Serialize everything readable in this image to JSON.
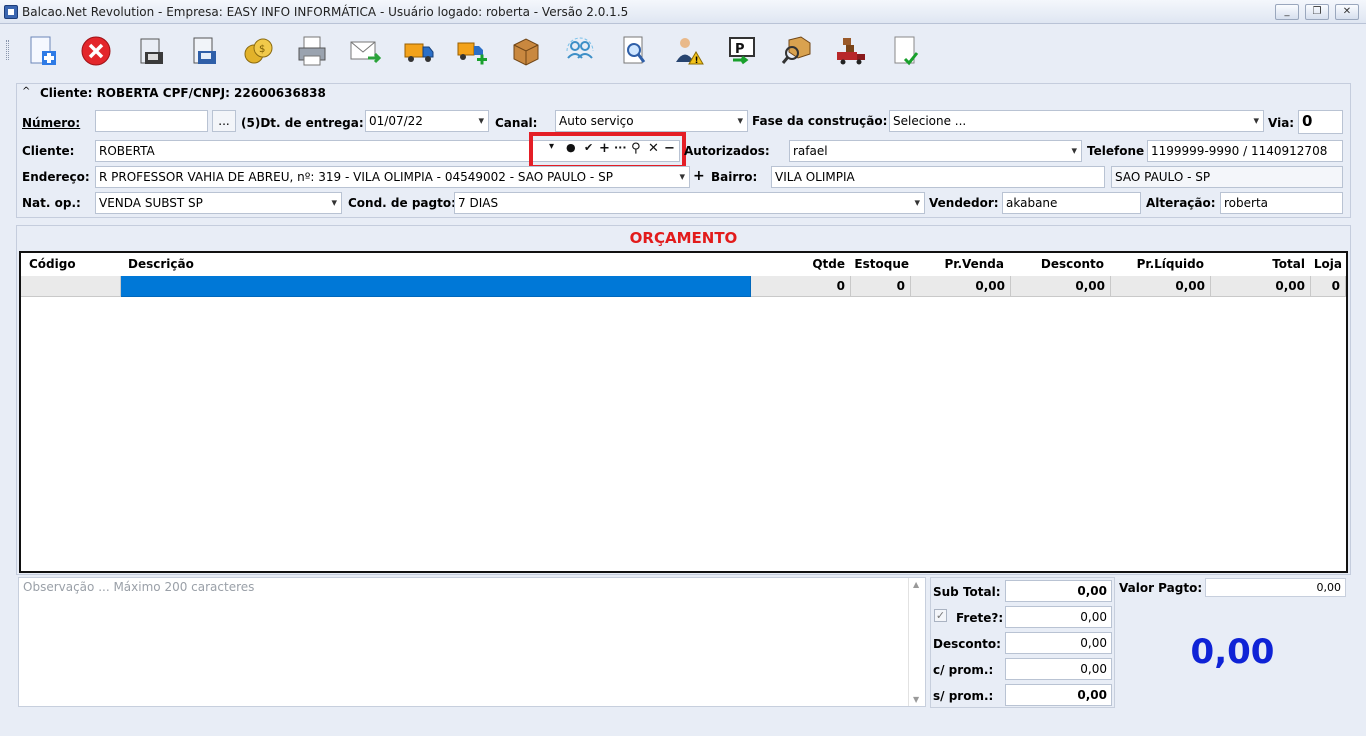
{
  "window": {
    "title": "Balcao.Net Revolution - Empresa: EASY INFO INFORMÁTICA - Usuário logado: roberta - Versão 2.0.1.5",
    "minimize": "_",
    "restore": "❐",
    "close": "✕"
  },
  "toolbar": {
    "buttons": [
      {
        "name": "new-doc-icon"
      },
      {
        "name": "cancel-icon"
      },
      {
        "name": "save-icon"
      },
      {
        "name": "save-as-icon"
      },
      {
        "name": "coins-icon"
      },
      {
        "name": "print-icon"
      },
      {
        "name": "email-icon"
      },
      {
        "name": "truck-icon"
      },
      {
        "name": "truck-add-icon"
      },
      {
        "name": "box-icon"
      },
      {
        "name": "users-sync-icon"
      },
      {
        "name": "search-doc-icon"
      },
      {
        "name": "user-warning-icon"
      },
      {
        "name": "report-icon"
      },
      {
        "name": "package-search-icon"
      },
      {
        "name": "delivery-icon"
      },
      {
        "name": "confirm-doc-icon"
      }
    ]
  },
  "header": {
    "client_summary": "Cliente: ROBERTA CPF/CNPJ: 22600636838",
    "collapse_glyph": "^"
  },
  "form": {
    "numero_label": "Número:",
    "numero_value": "",
    "ellipsis": "...",
    "count_dt_label": "(5)Dt. de entrega:",
    "dt_entrega": "01/07/22",
    "canal_label": "Canal:",
    "canal_value": "Auto serviço",
    "fase_label": "Fase da construção:",
    "fase_value": "Selecione ...",
    "via_label": "Via:",
    "via_value": "0",
    "cliente_label": "Cliente:",
    "cliente_value": "ROBERTA",
    "autorizados_label": "Autorizados:",
    "autorizados_value": "rafael",
    "telefone_label": "Telefone",
    "telefone_value": "1199999-9990 / 1140912708",
    "endereco_label": "Endereço:",
    "endereco_value": "R PROFESSOR VAHIA DE ABREU, nº: 319 - VILA OLIMPIA - 04549002 - SAO PAULO - SP",
    "add_glyph": "+",
    "bairro_label": "Bairro:",
    "bairro_value": "VILA OLIMPIA",
    "cidade_value": "SAO PAULO - SP",
    "natop_label": "Nat. op.:",
    "natop_value": "VENDA SUBST SP",
    "cond_label": "Cond. de pagto:",
    "cond_value": "7 DIAS",
    "vendedor_label": "Vendedor:",
    "vendedor_value": "akabane",
    "alteracao_label": "Alteração:",
    "alteracao_value": "roberta"
  },
  "client_tools": {
    "dropdown": "▾",
    "pin": "●",
    "check": "✔",
    "plus": "+",
    "more": "···",
    "search": "⚲",
    "clear": "✕",
    "minus": "−"
  },
  "grid": {
    "title": "ORÇAMENTO",
    "columns": [
      "Código",
      "Descrição",
      "Qtde",
      "Estoque",
      "Pr.Venda",
      "Desconto",
      "Pr.Líquido",
      "Total",
      "Loja"
    ],
    "row": [
      "",
      "",
      "0",
      "0",
      "0,00",
      "0,00",
      "0,00",
      "0,00",
      "0"
    ]
  },
  "footer": {
    "obs_placeholder": "Observação ... Máximo 200 caracteres",
    "subtotal_label": "Sub Total:",
    "subtotal_value": "0,00",
    "frete_label": "Frete?:",
    "frete_value": "0,00",
    "frete_checked": true,
    "desconto_label": "Desconto:",
    "desconto_value": "0,00",
    "cprom_label": "c/ prom.:",
    "cprom_value": "0,00",
    "sprom_label": "s/ prom.:",
    "sprom_value": "0,00",
    "valor_pagto_label": "Valor Pagto:",
    "valor_pagto_value": "0,00",
    "big_total": "0,00"
  },
  "colors": {
    "accent_red": "#e21b1b",
    "selection_blue": "#0078d7",
    "total_blue": "#0f23d6"
  }
}
